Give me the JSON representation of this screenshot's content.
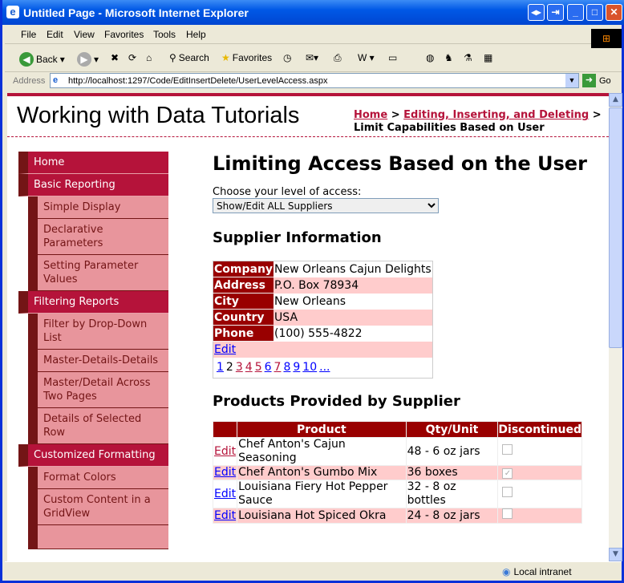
{
  "window": {
    "title": "Untitled Page - Microsoft Internet Explorer"
  },
  "menu": [
    "File",
    "Edit",
    "View",
    "Favorites",
    "Tools",
    "Help"
  ],
  "toolbar": {
    "back": "Back",
    "search": "Search",
    "favorites": "Favorites"
  },
  "address": {
    "label": "Address",
    "url": "http://localhost:1297/Code/EditInsertDelete/UserLevelAccess.aspx",
    "go": "Go"
  },
  "header": {
    "title": "Working with Data Tutorials",
    "breadcrumb": {
      "home": "Home",
      "sep": ">",
      "section": "Editing, Inserting, and Deleting",
      "current": "Limit Capabilities Based on User"
    }
  },
  "sidebar": [
    {
      "label": "Home",
      "level": "top"
    },
    {
      "label": "Basic Reporting",
      "level": "top"
    },
    {
      "label": "Simple Display",
      "level": "sub"
    },
    {
      "label": "Declarative Parameters",
      "level": "sub"
    },
    {
      "label": "Setting Parameter Values",
      "level": "sub"
    },
    {
      "label": "Filtering Reports",
      "level": "top"
    },
    {
      "label": "Filter by Drop-Down List",
      "level": "sub"
    },
    {
      "label": "Master-Details-Details",
      "level": "sub"
    },
    {
      "label": "Master/Detail Across Two Pages",
      "level": "sub"
    },
    {
      "label": "Details of Selected Row",
      "level": "sub"
    },
    {
      "label": "Customized Formatting",
      "level": "top"
    },
    {
      "label": "Format Colors",
      "level": "sub"
    },
    {
      "label": "Custom Content in a GridView",
      "level": "sub"
    }
  ],
  "main": {
    "title": "Limiting Access Based on the User",
    "access_label": "Choose your level of access:",
    "access_selected": "Show/Edit ALL Suppliers",
    "supplier_heading": "Supplier Information",
    "supplier": [
      {
        "label": "Company",
        "value": "New Orleans Cajun Delights"
      },
      {
        "label": "Address",
        "value": "P.O. Box 78934"
      },
      {
        "label": "City",
        "value": "New Orleans"
      },
      {
        "label": "Country",
        "value": "USA"
      },
      {
        "label": "Phone",
        "value": "(100) 555-4822"
      }
    ],
    "supplier_edit": "Edit",
    "pager": [
      "1",
      "2",
      "3",
      "4",
      "5",
      "6",
      "7",
      "8",
      "9",
      "10",
      "..."
    ],
    "pager_current": "2",
    "products_heading": "Products Provided by Supplier",
    "products_columns": [
      "",
      "Product",
      "Qty/Unit",
      "Discontinued"
    ],
    "products": [
      {
        "edit": "Edit",
        "product": "Chef Anton's Cajun Seasoning",
        "qty": "48 - 6 oz jars",
        "discontinued": false
      },
      {
        "edit": "Edit",
        "product": "Chef Anton's Gumbo Mix",
        "qty": "36 boxes",
        "discontinued": true
      },
      {
        "edit": "Edit",
        "product": "Louisiana Fiery Hot Pepper Sauce",
        "qty": "32 - 8 oz bottles",
        "discontinued": false
      },
      {
        "edit": "Edit",
        "product": "Louisiana Hot Spiced Okra",
        "qty": "24 - 8 oz jars",
        "discontinued": false
      }
    ]
  },
  "status": {
    "zone": "Local intranet"
  },
  "colors": {
    "brand": "#b5133a",
    "dark": "#731516",
    "header_cell": "#990000",
    "alt_row": "#ffcccc",
    "sub_item": "#e8959c"
  }
}
